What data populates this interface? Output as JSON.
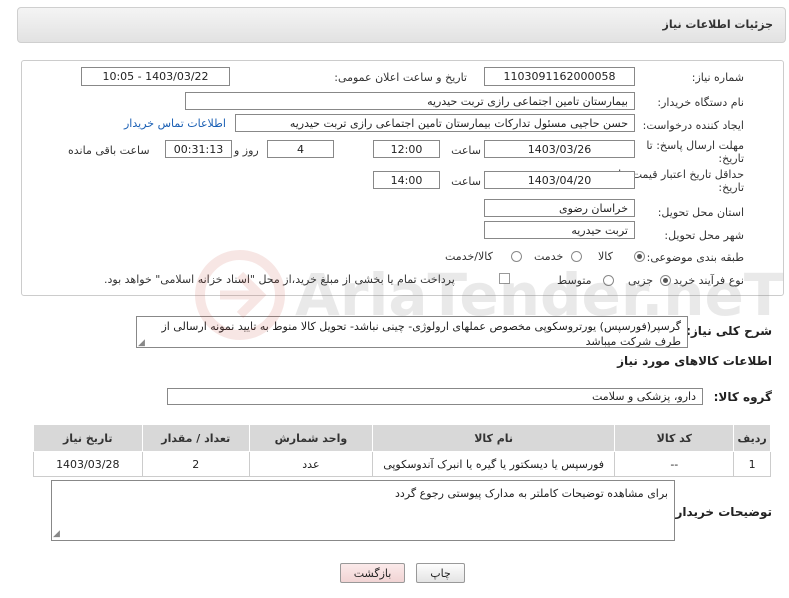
{
  "header": {
    "title": "جزئیات اطلاعات نیاز"
  },
  "form": {
    "need_number_label": "شماره نیاز:",
    "need_number": "1103091162000058",
    "announce_label": "تاریخ و ساعت اعلان عمومی:",
    "announce_value": "1403/03/22 - 10:05",
    "buyer_org_label": "نام دستگاه خریدار:",
    "buyer_org": "بیمارستان تامین اجتماعی رازی تربت حیدریه",
    "creator_label": "ایجاد کننده درخواست:",
    "creator": "حسن حاجیی مسئول تدارکات بیمارستان تامین اجتماعی رازی تربت حیدریه",
    "contact_link": "اطلاعات تماس خریدار",
    "reply_deadline_label_1": "مهلت ارسال پاسخ: تا",
    "reply_deadline_label_2": "تاریخ:",
    "reply_date": "1403/03/26",
    "time_label": "ساعت",
    "reply_time": "12:00",
    "days_value": "4",
    "days_label": "روز و",
    "remaining_time": "00:31:13",
    "remaining_label": "ساعت باقی مانده",
    "validity_label_1": "حداقل تاریخ اعتبار قیمت: تا",
    "validity_label_2": "تاریخ:",
    "validity_date": "1403/04/20",
    "validity_time": "14:00",
    "province_label": "استان محل تحویل:",
    "province": "خراسان رضوی",
    "city_label": "شهر محل تحویل:",
    "city": "تربت حیدریه",
    "category_label": "طبقه بندی موضوعی:",
    "category_options": [
      "کالا",
      "خدمت",
      "کالا/خدمت"
    ],
    "category_selected": "کالا",
    "process_label": "نوع فرآیند خرید :",
    "process_options": [
      "جزیی",
      "متوسط"
    ],
    "process_selected": "جزیی",
    "payment_note": "پرداخت تمام یا بخشی از مبلغ خرید،از محل \"اسناد خزانه اسلامی\" خواهد بود."
  },
  "description": {
    "label": "شرح کلی نیاز:",
    "text": "گرسپر(فورسپس) یورتروسکوپی مخصوص عملهای ارولوژی- چینی نباشد- تحویل کالا منوط به تایید نمونه ارسالی از طرف شرکت میباشد"
  },
  "goods": {
    "section_title": "اطلاعات کالاهای مورد نیاز",
    "group_label": "گروه کالا:",
    "group_value": "دارو، پزشکی و سلامت",
    "columns": [
      "ردیف",
      "کد کالا",
      "نام کالا",
      "واحد شمارش",
      "تعداد / مقدار",
      "تاریخ نیاز"
    ],
    "rows": [
      [
        "1",
        "--",
        "فورسپس یا دیسکتور یا گیره یا انبرک آندوسکوپی",
        "عدد",
        "2",
        "1403/03/28"
      ]
    ]
  },
  "buyer_notes": {
    "label": "توضیحات خریدار:",
    "text": "برای مشاهده توضیحات کاملتر به مدارک پیوستی رجوع گردد"
  },
  "buttons": {
    "print": "چاپ",
    "back": "بازگشت"
  },
  "watermark": {
    "text": "AriaTender.neT"
  },
  "colors": {
    "link": "#1a5fb4",
    "header_bg": "#e2e2e2",
    "table_header_bg": "#d8d8d8",
    "back_button_bg": "#f6dede"
  }
}
